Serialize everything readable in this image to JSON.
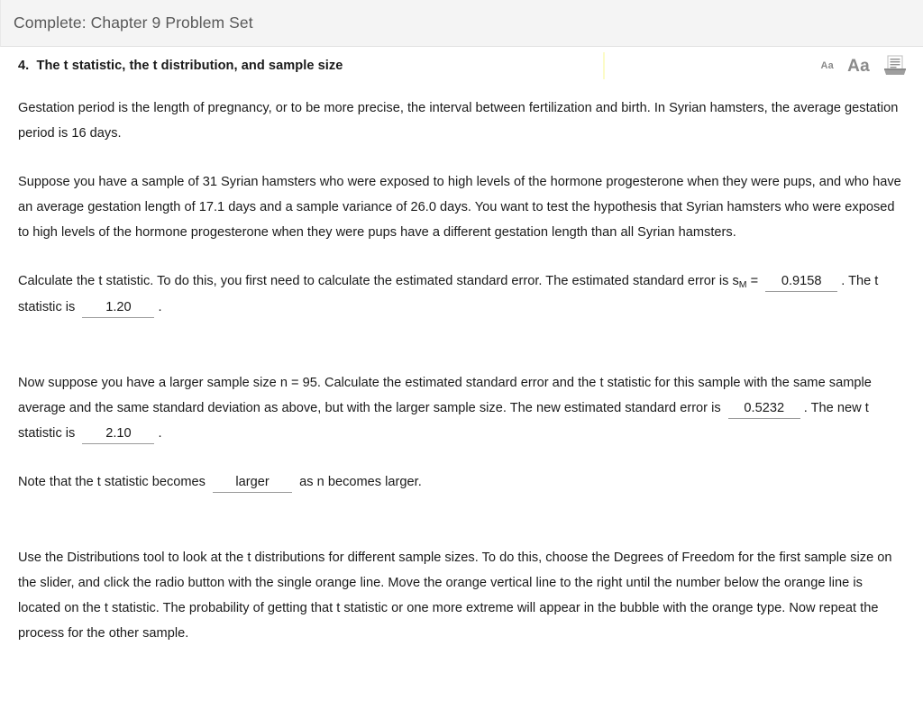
{
  "window": {
    "title": "Complete: Chapter 9 Problem Set"
  },
  "heading": {
    "number": "4.",
    "text": "The t statistic, the t distribution, and sample size",
    "full": "4.  The t statistic, the t distribution, and sample size",
    "divider_color": "#fcfbc8"
  },
  "tools": {
    "decrease_font_label": "Aa",
    "increase_font_label": "Aa",
    "print_icon": "printer-icon",
    "icon_color": "#8a8a8a"
  },
  "content": {
    "paragraph_1": "Gestation period is the length of pregnancy, or to be more precise, the interval between fertilization and birth. In Syrian hamsters, the average gestation period is 16 days.",
    "paragraph_2": "Suppose you have a sample of 31 Syrian hamsters who were exposed to high levels of the hormone progesterone when they were pups, and who have an average gestation length of 17.1 days and a sample variance of 26.0 days. You want to test the hypothesis that Syrian hamsters who were exposed to high levels of the hormone progesterone when they were pups have a different gestation length than all Syrian hamsters.",
    "paragraph_3_a": "Calculate the t statistic. To do this, you first need to calculate the estimated standard error. The estimated standard error is s",
    "paragraph_3_sub": "M",
    "paragraph_3_b": " = ",
    "paragraph_3_c": ". The t statistic is ",
    "paragraph_3_d": ".",
    "paragraph_4_a": "Now suppose you have a larger sample size n = 95. Calculate the estimated standard error and the t statistic for this sample with the same sample average and the same standard deviation as above, but with the larger sample size. The new estimated standard error is ",
    "paragraph_4_b": ". The new t statistic is ",
    "paragraph_4_c": ".",
    "paragraph_5_a": "Note that the t statistic becomes ",
    "paragraph_5_b": " as n becomes larger.",
    "paragraph_6": "Use the Distributions tool to look at the t distributions for different sample sizes. To do this, choose the Degrees of Freedom for the first sample size on the slider, and click the radio button with the single orange line. Move the orange vertical line to the right until the number below the orange line is located on the t statistic. The probability of getting that t statistic or one more extreme will appear in the bubble with the orange type. Now repeat the process for the other sample."
  },
  "answers": {
    "standard_error_1": "0.9158",
    "t_statistic_1": "1.20",
    "standard_error_2": "0.5232",
    "t_statistic_2": "2.10",
    "comparison": "larger"
  }
}
